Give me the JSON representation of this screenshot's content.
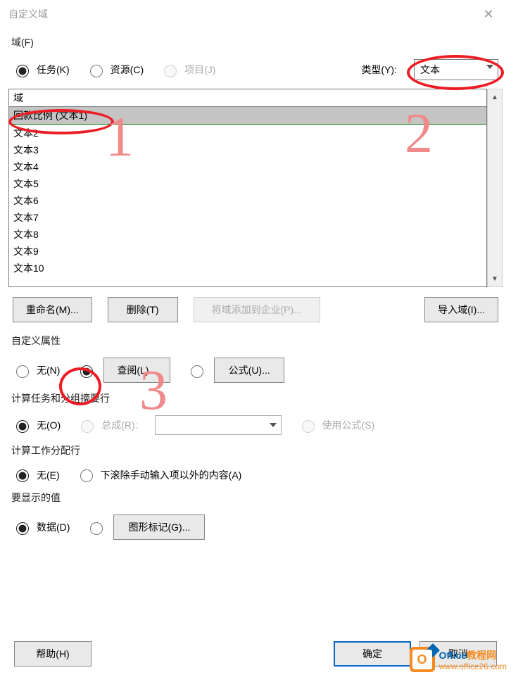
{
  "window": {
    "title": "自定义域"
  },
  "field_group": {
    "label": "域(F)",
    "radios": {
      "task": "任务(K)",
      "resource": "资源(C)",
      "project": "项目(J)"
    },
    "type_label": "类型(Y):",
    "type_value": "文本",
    "list_header": "域",
    "items": [
      "回款比例 (文本1)",
      "文本2",
      "文本3",
      "文本4",
      "文本5",
      "文本6",
      "文本7",
      "文本8",
      "文本9",
      "文本10"
    ],
    "buttons": {
      "rename": "重命名(M)...",
      "delete": "删除(T)",
      "add_enterprise": "将域添加到企业(P)...",
      "import": "导入域(I)..."
    }
  },
  "custom_attr": {
    "label": "自定义属性",
    "none": "无(N)",
    "lookup": "查阅(L)...",
    "formula": "公式(U)..."
  },
  "calc_task": {
    "label": "计算任务和分组摘要行",
    "none": "无(O)",
    "rollup": "总成(R):",
    "use_formula": "使用公式(S)"
  },
  "calc_assign": {
    "label": "计算工作分配行",
    "none": "无(E)",
    "rolldown": "下滚除手动输入项以外的内容(A)"
  },
  "display_value": {
    "label": "要显示的值",
    "data": "数据(D)",
    "graphic": "图形标记(G)..."
  },
  "footer": {
    "help": "帮助(H)",
    "ok": "确定",
    "cancel": "取消"
  },
  "annotations": {
    "n1": "1",
    "n2": "2",
    "n3": "3"
  },
  "watermark": {
    "brand1a": "Office",
    "brand1b": "教程网",
    "url": "www.office26.com"
  }
}
